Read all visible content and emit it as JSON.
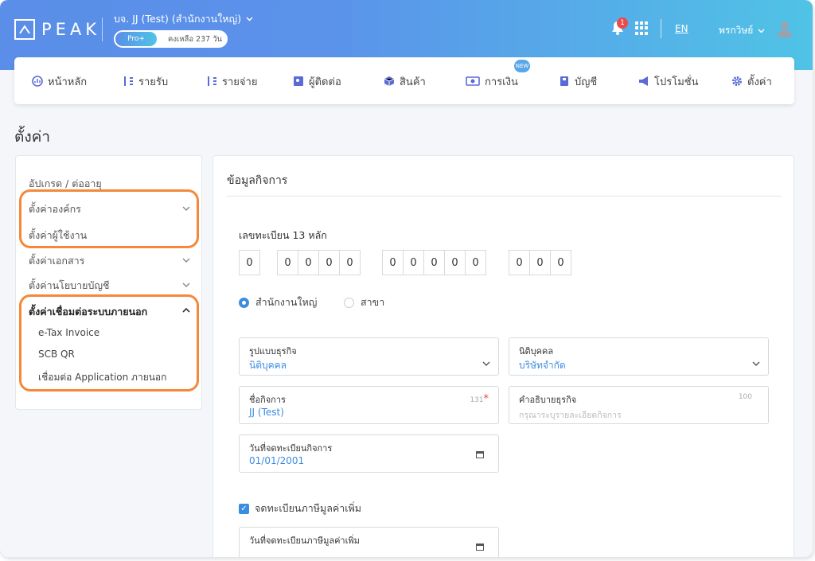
{
  "header": {
    "logo_text": "PEAK",
    "company_name": "บจ. JJ (Test) (สำนักงานใหญ่)",
    "plan_badge": "Pro+",
    "plan_remaining": "คงเหลือ 237 วัน",
    "notification_count": "1",
    "language": "EN",
    "user_name": "พรกวิษย์"
  },
  "nav": {
    "items": [
      {
        "label": "หน้าหลัก",
        "icon": "dashboard-icon"
      },
      {
        "label": "รายรับ",
        "icon": "income-icon"
      },
      {
        "label": "รายจ่าย",
        "icon": "expense-icon"
      },
      {
        "label": "ผู้ติดต่อ",
        "icon": "contact-icon"
      },
      {
        "label": "สินค้า",
        "icon": "product-box-icon"
      },
      {
        "label": "การเงิน",
        "icon": "money-icon"
      },
      {
        "label": "บัญชี",
        "icon": "accounting-book-icon"
      },
      {
        "label": "โปรโมชั่น",
        "icon": "megaphone-icon"
      },
      {
        "label": "ตั้งค่า",
        "icon": "gear-icon"
      }
    ],
    "new_badge": "NEW"
  },
  "page": {
    "title": "ตั้งค่า"
  },
  "sidebar": {
    "items": [
      {
        "label": "อัปเกรด / ต่ออายุ"
      },
      {
        "label": "ตั้งค่าองค์กร"
      },
      {
        "label": "ตั้งค่าผู้ใช้งาน"
      },
      {
        "label": "ตั้งค่าเอกสาร"
      },
      {
        "label": "ตั้งค่านโยบายบัญชี"
      },
      {
        "label": "ตั้งค่าเชื่อมต่อระบบภายนอก"
      }
    ],
    "sub_items": [
      {
        "label": "e-Tax Invoice"
      },
      {
        "label": "SCB QR"
      },
      {
        "label": "เชื่อมต่อ Application ภายนอก"
      }
    ]
  },
  "content": {
    "section_title": "ข้อมูลกิจการ",
    "tax_id_label": "เลขทะเบียน 13 หลัก",
    "tax_id_digits": [
      "0",
      "0",
      "0",
      "0",
      "0",
      "0",
      "0",
      "0",
      "0",
      "0",
      "0",
      "0",
      "0"
    ],
    "branch_options": [
      {
        "label": "สำนักงานใหญ่",
        "selected": true
      },
      {
        "label": "สาขา",
        "selected": false
      }
    ],
    "fields": {
      "business_type": {
        "label": "รูปแบบธุรกิจ",
        "value": "นิติบุคคล"
      },
      "juristic": {
        "label": "นิติบุคคล",
        "value": "บริษัทจำกัด"
      },
      "business_name": {
        "label": "ชื่อกิจการ",
        "value": "JJ (Test)",
        "count": "131",
        "required_mark": "*"
      },
      "business_desc": {
        "label": "คำอธิบายธุรกิจ",
        "placeholder": "กรุณาระบุรายละเอียดกิจการ",
        "count": "100"
      },
      "reg_date": {
        "label": "วันที่จดทะเบียนกิจการ",
        "value": "01/01/2001"
      },
      "vat_date": {
        "label": "วันที่จดทะเบียนภาษีมูลค่าเพิ่ม"
      }
    },
    "vat_checkbox": {
      "label": "จดทะเบียนภาษีมูลค่าเพิ่ม",
      "checked": true
    }
  },
  "colors": {
    "accent": "#3b8de0",
    "highlight": "#f5883a",
    "header_start": "#5a8ee8",
    "header_end": "#50c3e6"
  }
}
